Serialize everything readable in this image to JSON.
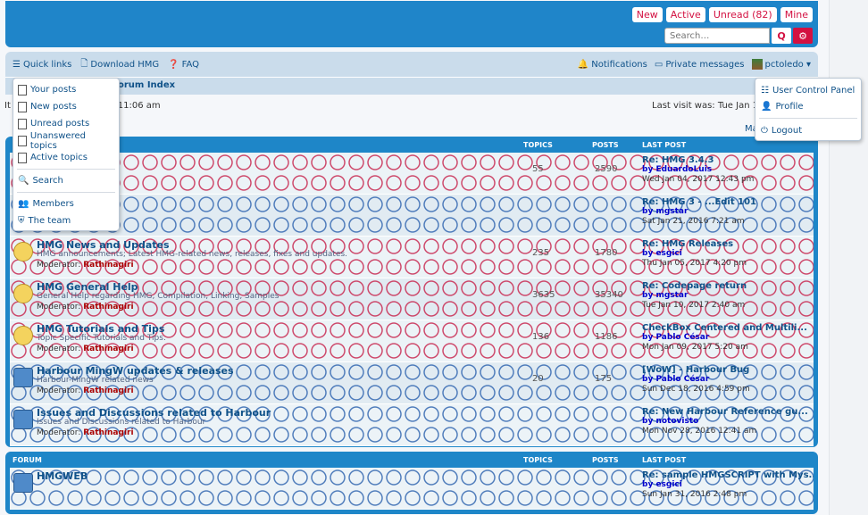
{
  "header": {
    "links": [
      "New",
      "Active",
      "Unread (82)",
      "Mine"
    ],
    "search_placeholder": "Search…",
    "search_button": "Q",
    "adv_button": "⚙"
  },
  "navbar": {
    "quick_links": "Quick links",
    "download": "Download HMG",
    "faq": "FAQ",
    "notifications": "Notifications",
    "pm": "Private messages",
    "user": "pctoledo ▾"
  },
  "breadcrumb": "orum Index",
  "visit": {
    "left": "17 11:06 am",
    "left_prefix": "It",
    "right": "Last visit was: Tue Jan 10",
    "mark": "Ma"
  },
  "quick_menu": [
    "Your posts",
    "New posts",
    "Unread posts",
    "Unanswered topics",
    "Active topics",
    "Search",
    "Members",
    "The team"
  ],
  "user_menu": [
    "User Control Panel",
    "Profile",
    "Logout"
  ],
  "cols": {
    "forum": "FORUM",
    "topics": "TOPICS",
    "posts": "POSTS",
    "last": "LAST POST"
  },
  "rows": [
    {
      "title": "",
      "desc": "",
      "mod": "",
      "topics": "55",
      "posts": "2590",
      "lp_title": "Re: HMG 3.4.3",
      "lp_by": "by EduardoLuis",
      "lp_date": "Wed Jan 04, 2017 12:43 pm",
      "style": "red"
    },
    {
      "title": "",
      "desc": "",
      "mod": "",
      "topics": "",
      "posts": "",
      "lp_title": "Re: HMG 3 - ...Edit 101",
      "lp_by": "by mgstar",
      "lp_date": "Sat Jan 21, 2016 7:21 am",
      "style": "blue"
    },
    {
      "title": "HMG News and Updates",
      "desc": "HMG announcements; Latest HMG-related news, releases, fixes and updates.",
      "mod": "Rathinagiri",
      "topics": "235",
      "posts": "1780",
      "lp_title": "Re: HMG Releases",
      "lp_by": "by esgici",
      "lp_date": "Thu Jan 05, 2017 4:20 pm",
      "style": "red"
    },
    {
      "title": "HMG General Help",
      "desc": "General Help regarding HMG, Compilation, Linking, Samples",
      "mod": "Rathinagiri",
      "topics": "3635",
      "posts": "35340",
      "lp_title": "Re: Codepage return",
      "lp_by": "by mgstar",
      "lp_date": "Tue Jan 10, 2017 2:40 am",
      "style": "red"
    },
    {
      "title": "HMG Tutorials and Tips",
      "desc": "Topic Specific Tutorials and Tips.",
      "mod": "Rathinagiri",
      "topics": "136",
      "posts": "1186",
      "lp_title": "CheckBox Centered and Multili...",
      "lp_by": "by Pablo César",
      "lp_date": "Mon Jan 09, 2017 5:20 am",
      "style": "red"
    },
    {
      "title": "Harbour MingW updates & releases",
      "desc": "Harbour-MingW related news",
      "mod": "Rathinagiri",
      "topics": "20",
      "posts": "175",
      "lp_title": "[WoW] - Harbour Bug",
      "lp_by": "by Pablo César",
      "lp_date": "Sun Dec 18, 2016 4:59 pm",
      "style": "blue"
    },
    {
      "title": "Issues and Discussions related to Harbour",
      "desc": "Issues and Discussions related to Harbour",
      "mod": "Rathinagiri",
      "topics": "",
      "posts": "",
      "lp_title": "Re: New Harbour Reference gu...",
      "lp_by": "by notovisto",
      "lp_date": "Mon Nov 28, 2016 12:41 am",
      "style": "blue"
    }
  ],
  "block2_rows": [
    {
      "title": "HMGWEB",
      "desc": "",
      "mod": "",
      "topics": "",
      "posts": "",
      "lp_title": "Re: sample HMGSCRIPT with Mys...",
      "lp_by": "by esgici",
      "lp_date": "Sun Jan 31, 2016 2:48 pm",
      "style": "blue"
    }
  ]
}
